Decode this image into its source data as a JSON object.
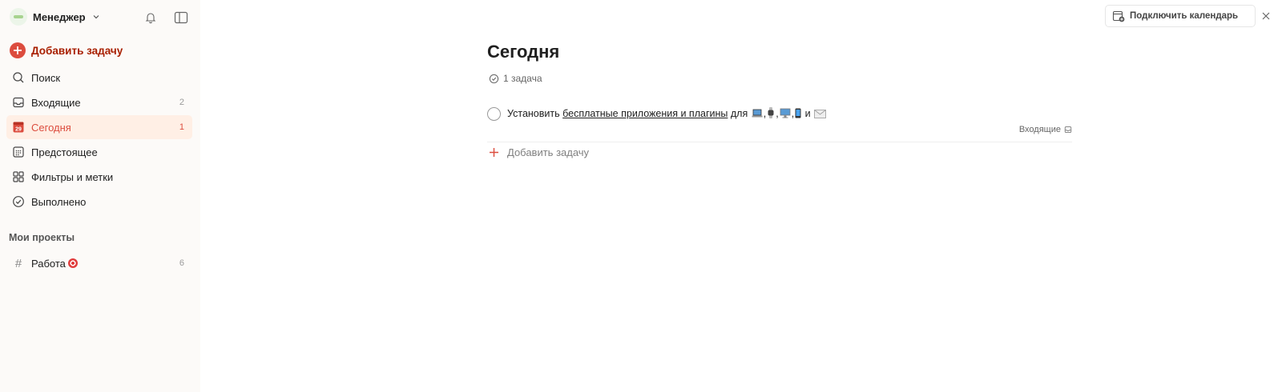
{
  "sidebar": {
    "user_name": "Менеджер",
    "add_task_label": "Добавить задачу",
    "items": [
      {
        "label": "Поиск",
        "count": ""
      },
      {
        "label": "Входящие",
        "count": "2"
      },
      {
        "label": "Сегодня",
        "count": "1"
      },
      {
        "label": "Предстоящее",
        "count": ""
      },
      {
        "label": "Фильтры и метки",
        "count": ""
      },
      {
        "label": "Выполнено",
        "count": ""
      }
    ],
    "projects_title": "Мои проекты",
    "projects": [
      {
        "label": "Работа",
        "count": "6"
      }
    ],
    "today_date": "29"
  },
  "calendar": {
    "connect_label": "Подключить календарь"
  },
  "main": {
    "title": "Сегодня",
    "task_count": "1 задача",
    "task": {
      "prefix": "Установить",
      "link": "бесплатные приложения и плагины",
      "for_word": "для",
      "comma": ",",
      "and_word": "и",
      "project": "Входящие"
    },
    "add_task_label": "Добавить задачу"
  },
  "colors": {
    "accent": "#dc4c3e",
    "accent_text": "#a81f00",
    "active_bg": "#ffefe5",
    "sidebar_bg": "#fcfaf8"
  }
}
